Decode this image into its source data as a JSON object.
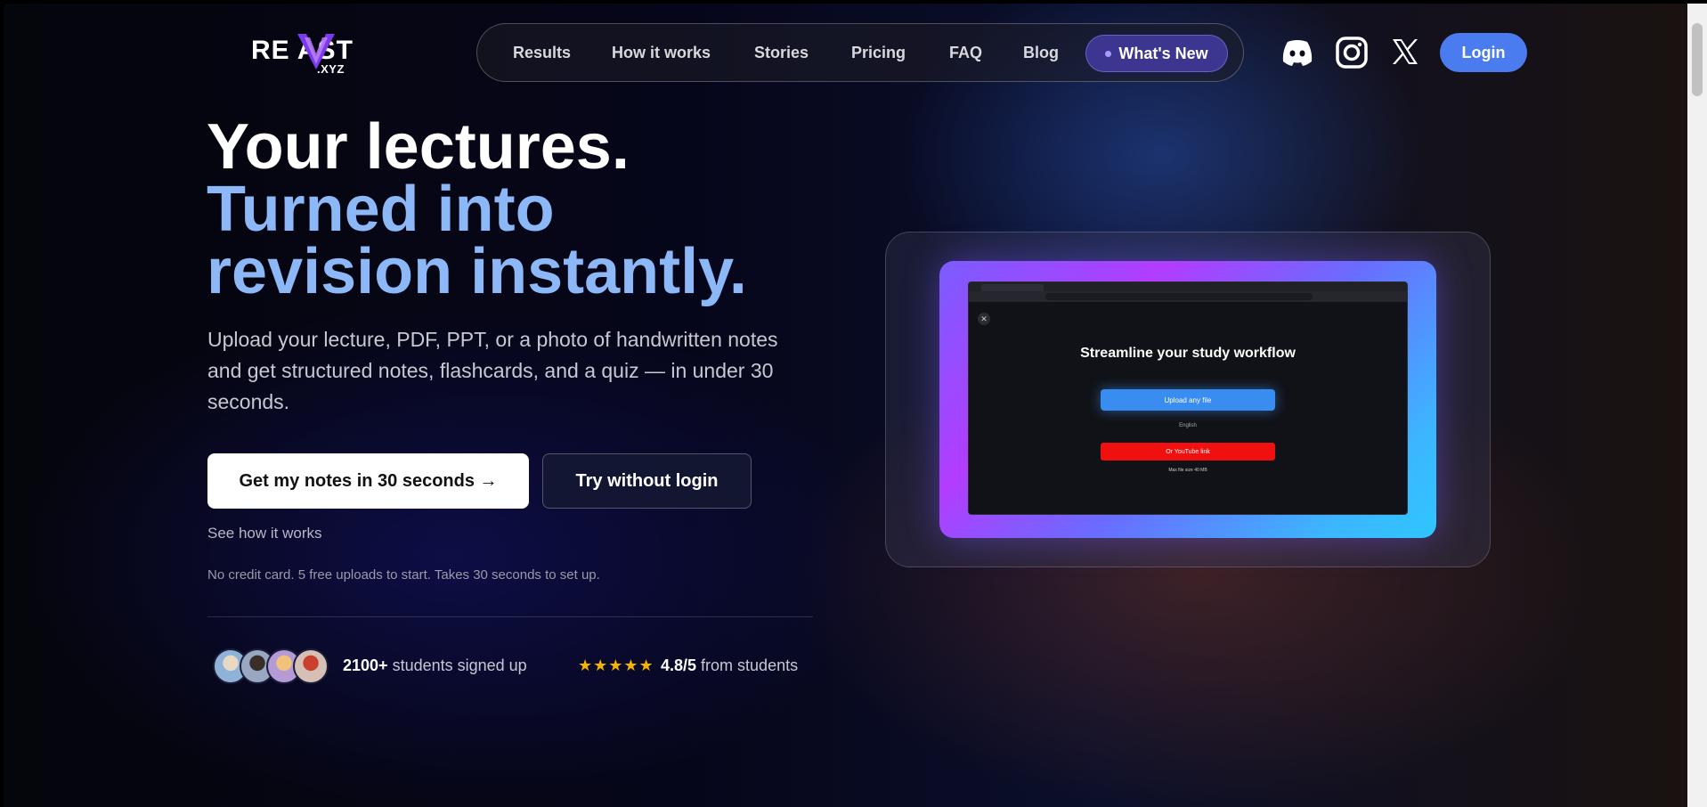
{
  "header": {
    "logo_main": "RE  AST",
    "logo_sub": ".XYZ",
    "nav": [
      {
        "label": "Results"
      },
      {
        "label": "How it works"
      },
      {
        "label": "Stories"
      },
      {
        "label": "Pricing"
      },
      {
        "label": "FAQ"
      },
      {
        "label": "Blog"
      }
    ],
    "whats_new": "What's New",
    "socials": [
      "discord-icon",
      "instagram-icon",
      "x-icon"
    ],
    "login": "Login"
  },
  "hero": {
    "line1": "Your lectures.",
    "line2": "Turned into",
    "line3": "revision instantly.",
    "subtext": "Upload your lecture, PDF, PPT, or a photo of handwritten notes and get structured notes, flashcards, and a quiz — in under 30 seconds.",
    "cta_primary": "Get my notes in 30 seconds →",
    "cta_secondary": "Try without login",
    "see_how": "See how it works",
    "fineprint": "No credit card. 5 free uploads to start. Takes 30 seconds to set up."
  },
  "social_proof": {
    "count": "2100+",
    "count_suffix": " students signed up",
    "stars": "★★★★★",
    "rating": "4.8/5",
    "rating_suffix": " from students"
  },
  "demo": {
    "title": "Streamline your study workflow",
    "upload_label": "Upload any file",
    "language": "English",
    "youtube_label": "Or YouTube link",
    "note": "Max file size 40 MB"
  },
  "colors": {
    "accent": "#8db8f7",
    "login": "#4a7cf0",
    "whats_new": "#3c3690",
    "stars": "#f5b400",
    "youtube": "#f01010"
  }
}
